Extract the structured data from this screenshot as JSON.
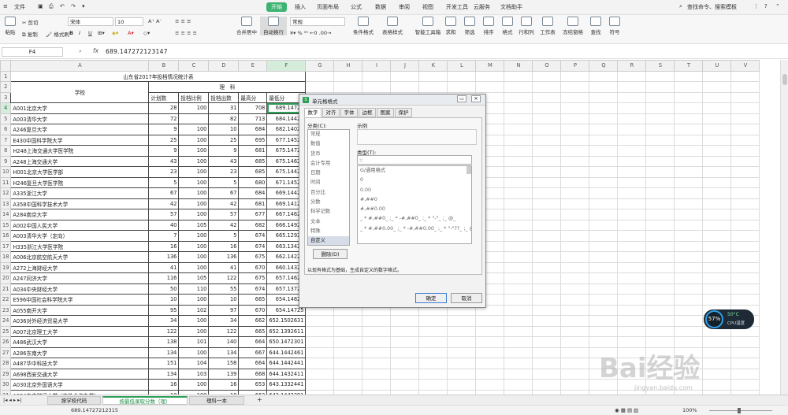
{
  "menubar": {
    "file": "文件",
    "tabs": [
      "开始",
      "插入",
      "页面布局",
      "公式",
      "数据",
      "审阅",
      "视图",
      "开发工具",
      "云服务",
      "文档助手"
    ],
    "active_tab": "开始",
    "search": "查找命令、搜索模板"
  },
  "ribbon": {
    "paste": "粘贴",
    "cut": "剪切",
    "copy": "复制",
    "format_painter": "格式刷",
    "font_name": "宋体",
    "font_size": "10",
    "merge": "合并居中",
    "wrap": "自动换行",
    "number_format": "常规",
    "cond_format": "条件格式",
    "table_style": "表格样式",
    "sum": "求和",
    "filter": "筛选",
    "sort": "排序",
    "format": "格式",
    "rowcol": "行和列",
    "worksheet": "工作表",
    "freeze": "冻结窗格",
    "find": "查找",
    "symbol": "符号",
    "smart_toolbox": "智能工具箱",
    "bold": "B",
    "italic": "I",
    "underline": "U"
  },
  "formula_bar": {
    "cell_ref": "F4",
    "fx": "fx",
    "value": "689.147272123147"
  },
  "sheet": {
    "columns": [
      "A",
      "B",
      "C",
      "D",
      "E",
      "F",
      "G",
      "H",
      "I",
      "J",
      "K",
      "L",
      "M",
      "N",
      "O",
      "P",
      "Q",
      "R",
      "S",
      "T",
      "U",
      "V"
    ],
    "title": "山东省2017年投档情况统计表",
    "header_school": "学校",
    "header_science": "理　科",
    "headers": [
      "计划数",
      "投档比例",
      "投档出数",
      "最高分",
      "最低分"
    ],
    "rows": [
      [
        "A001北京大学",
        "28",
        "100",
        "31",
        "708",
        "689.14727"
      ],
      [
        "A003清华大学",
        "72",
        "",
        "82",
        "713",
        "684.14426"
      ],
      [
        "A246复旦大学",
        "9",
        "100",
        "10",
        "684",
        "682.14027"
      ],
      [
        "E430中国科学院大学",
        "25",
        "100",
        "25",
        "695",
        "677.14525"
      ],
      [
        "H248上海交通大学医学院",
        "9",
        "100",
        "9",
        "681",
        "675.14726"
      ],
      [
        "A248上海交通大学",
        "43",
        "100",
        "43",
        "685",
        "675.14625"
      ],
      [
        "H001北京大学医学部",
        "23",
        "100",
        "23",
        "685",
        "675.14426"
      ],
      [
        "H246复旦大学医学院",
        "5",
        "100",
        "5",
        "680",
        "671.14526"
      ],
      [
        "A335浙江大学",
        "67",
        "100",
        "67",
        "684",
        "669.14425"
      ],
      [
        "A358中国科学技术大学",
        "42",
        "100",
        "42",
        "681",
        "669.14126"
      ],
      [
        "A284南京大学",
        "57",
        "100",
        "57",
        "677",
        "667.14625"
      ],
      [
        "A002中国人民大学",
        "40",
        "105",
        "42",
        "682",
        "666.14925"
      ],
      [
        "A003清华大学（定向）",
        "7",
        "100",
        "5",
        "674",
        "665.12926"
      ],
      [
        "H335浙江大学医学院",
        "16",
        "100",
        "16",
        "674",
        "663.13425"
      ],
      [
        "A006北京航空航天大学",
        "136",
        "100",
        "136",
        "675",
        "662.14225"
      ],
      [
        "A272上海财经大学",
        "41",
        "100",
        "41",
        "670",
        "660.14326"
      ],
      [
        "A247同济大学",
        "116",
        "105",
        "122",
        "675",
        "657.14625"
      ],
      [
        "A034中央财经大学",
        "50",
        "110",
        "55",
        "674",
        "657.13726"
      ],
      [
        "E596中国社会科学院大学",
        "10",
        "100",
        "10",
        "665",
        "654.14824"
      ],
      [
        "A055南开大学",
        "95",
        "102",
        "97",
        "670",
        "654.14725"
      ],
      [
        "A036对外经济贸易大学",
        "34",
        "100",
        "34",
        "662",
        "652.1502631"
      ],
      [
        "A007北京理工大学",
        "122",
        "100",
        "122",
        "665",
        "652.1392611"
      ],
      [
        "A486武汉大学",
        "138",
        "101",
        "140",
        "664",
        "650.1472301"
      ],
      [
        "A286东南大学",
        "134",
        "100",
        "134",
        "667",
        "644.1442461"
      ],
      [
        "A487华中科技大学",
        "151",
        "104",
        "158",
        "664",
        "644.1442441"
      ],
      [
        "A698西安交通大学",
        "134",
        "103",
        "139",
        "668",
        "644.1432411"
      ],
      [
        "A030北京外国语大学",
        "16",
        "100",
        "16",
        "653",
        "643.1332441"
      ],
      [
        "A034中央财经大学（中外合作办学）",
        "10",
        "100",
        "10",
        "662",
        "642.1442391"
      ]
    ]
  },
  "dialog": {
    "title": "单元格格式",
    "tabs": [
      "数字",
      "对齐",
      "字体",
      "边框",
      "图案",
      "保护"
    ],
    "category_label": "分类(C):",
    "categories": [
      "常规",
      "数值",
      "货币",
      "会计专用",
      "日期",
      "时间",
      "百分比",
      "分数",
      "科学记数",
      "文本",
      "特殊",
      "自定义"
    ],
    "selected_category": "自定义",
    "sample_label": "示例",
    "type_label": "类型(T):",
    "type_value": "::",
    "formats": [
      "G/通用格式",
      "0",
      "0.00",
      "#,##0",
      "#,##0.00",
      "_ * #,##0_ ;_ * -#,##0_ ;_ * \"-\"_ ;_ @_",
      "_ * #,##0.00_ ;_ * -#,##0.00_ ;_ * \"-\"??_ ;_ @_"
    ],
    "delete": "删除(D)",
    "hint": "以现有格式为基础，生成自定义的数字格式。",
    "ok": "确定",
    "cancel": "取消"
  },
  "sheet_tabs": [
    "按学校代码",
    "按最低录取分数（理）",
    "理科一本"
  ],
  "active_sheet": "按最低录取分数（理）",
  "status": {
    "value": "689.14727212315",
    "zoom": "100%"
  },
  "cpu": {
    "percent": "57%",
    "temp": "50°C",
    "label": "CPU温度"
  },
  "watermark": {
    "main": "Bai经验",
    "sub": "jingyan.baidu.com"
  }
}
